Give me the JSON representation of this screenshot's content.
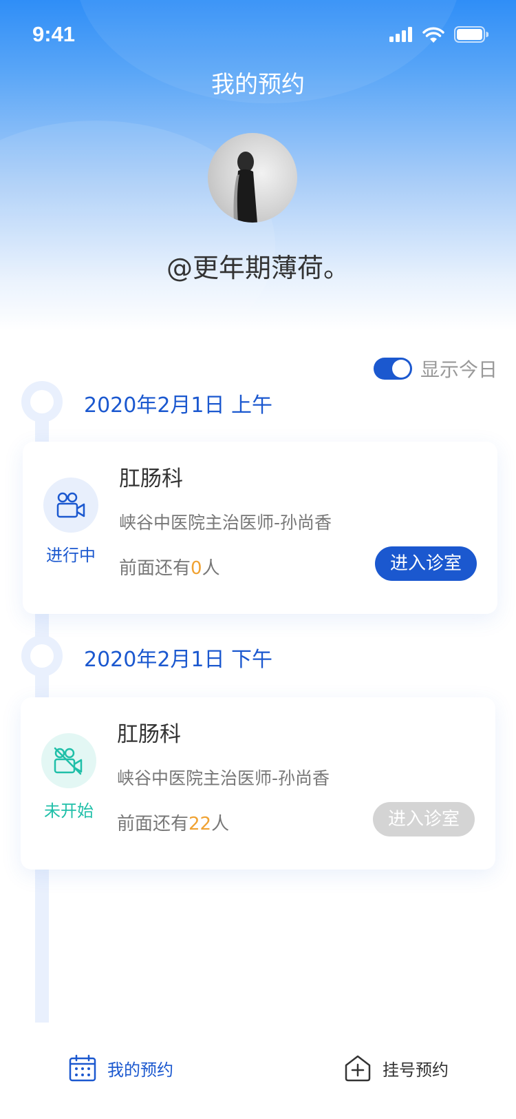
{
  "status_bar": {
    "time": "9:41"
  },
  "page": {
    "title": "我的预约"
  },
  "profile": {
    "username": "@更年期薄荷。"
  },
  "filter": {
    "label": "显示今日",
    "enabled": true
  },
  "appointments": [
    {
      "date": "2020年2月1日  上午",
      "department": "肛肠科",
      "doctor": "峡谷中医院主治医师-孙尚香",
      "queue_prefix": "前面还有",
      "queue_count": "0",
      "queue_suffix": "人",
      "status": "进行中",
      "status_color": "#1b58cf",
      "icon": "video-camera-icon",
      "button_label": "进入诊室",
      "button_enabled": true,
      "button_color": "#1b58cf"
    },
    {
      "date": "2020年2月1日  下午",
      "department": "肛肠科",
      "doctor": "峡谷中医院主治医师-孙尚香",
      "queue_prefix": "前面还有",
      "queue_count": "22",
      "queue_suffix": "人",
      "status": "未开始",
      "status_color": "#1fbfa8",
      "icon": "video-camera-icon",
      "button_label": "进入诊室",
      "button_enabled": false,
      "button_color": "#d4d4d4"
    }
  ],
  "tabbar": {
    "items": [
      {
        "label": "我的预约",
        "icon": "calendar-icon",
        "active": true,
        "color": "#1b58cf"
      },
      {
        "label": "挂号预约",
        "icon": "add-house-icon",
        "active": false,
        "color": "#333333"
      }
    ]
  },
  "colors": {
    "accent": "#1b58cf",
    "queue_highlight": "#f0a232",
    "timeline": "#e9f0fd"
  }
}
